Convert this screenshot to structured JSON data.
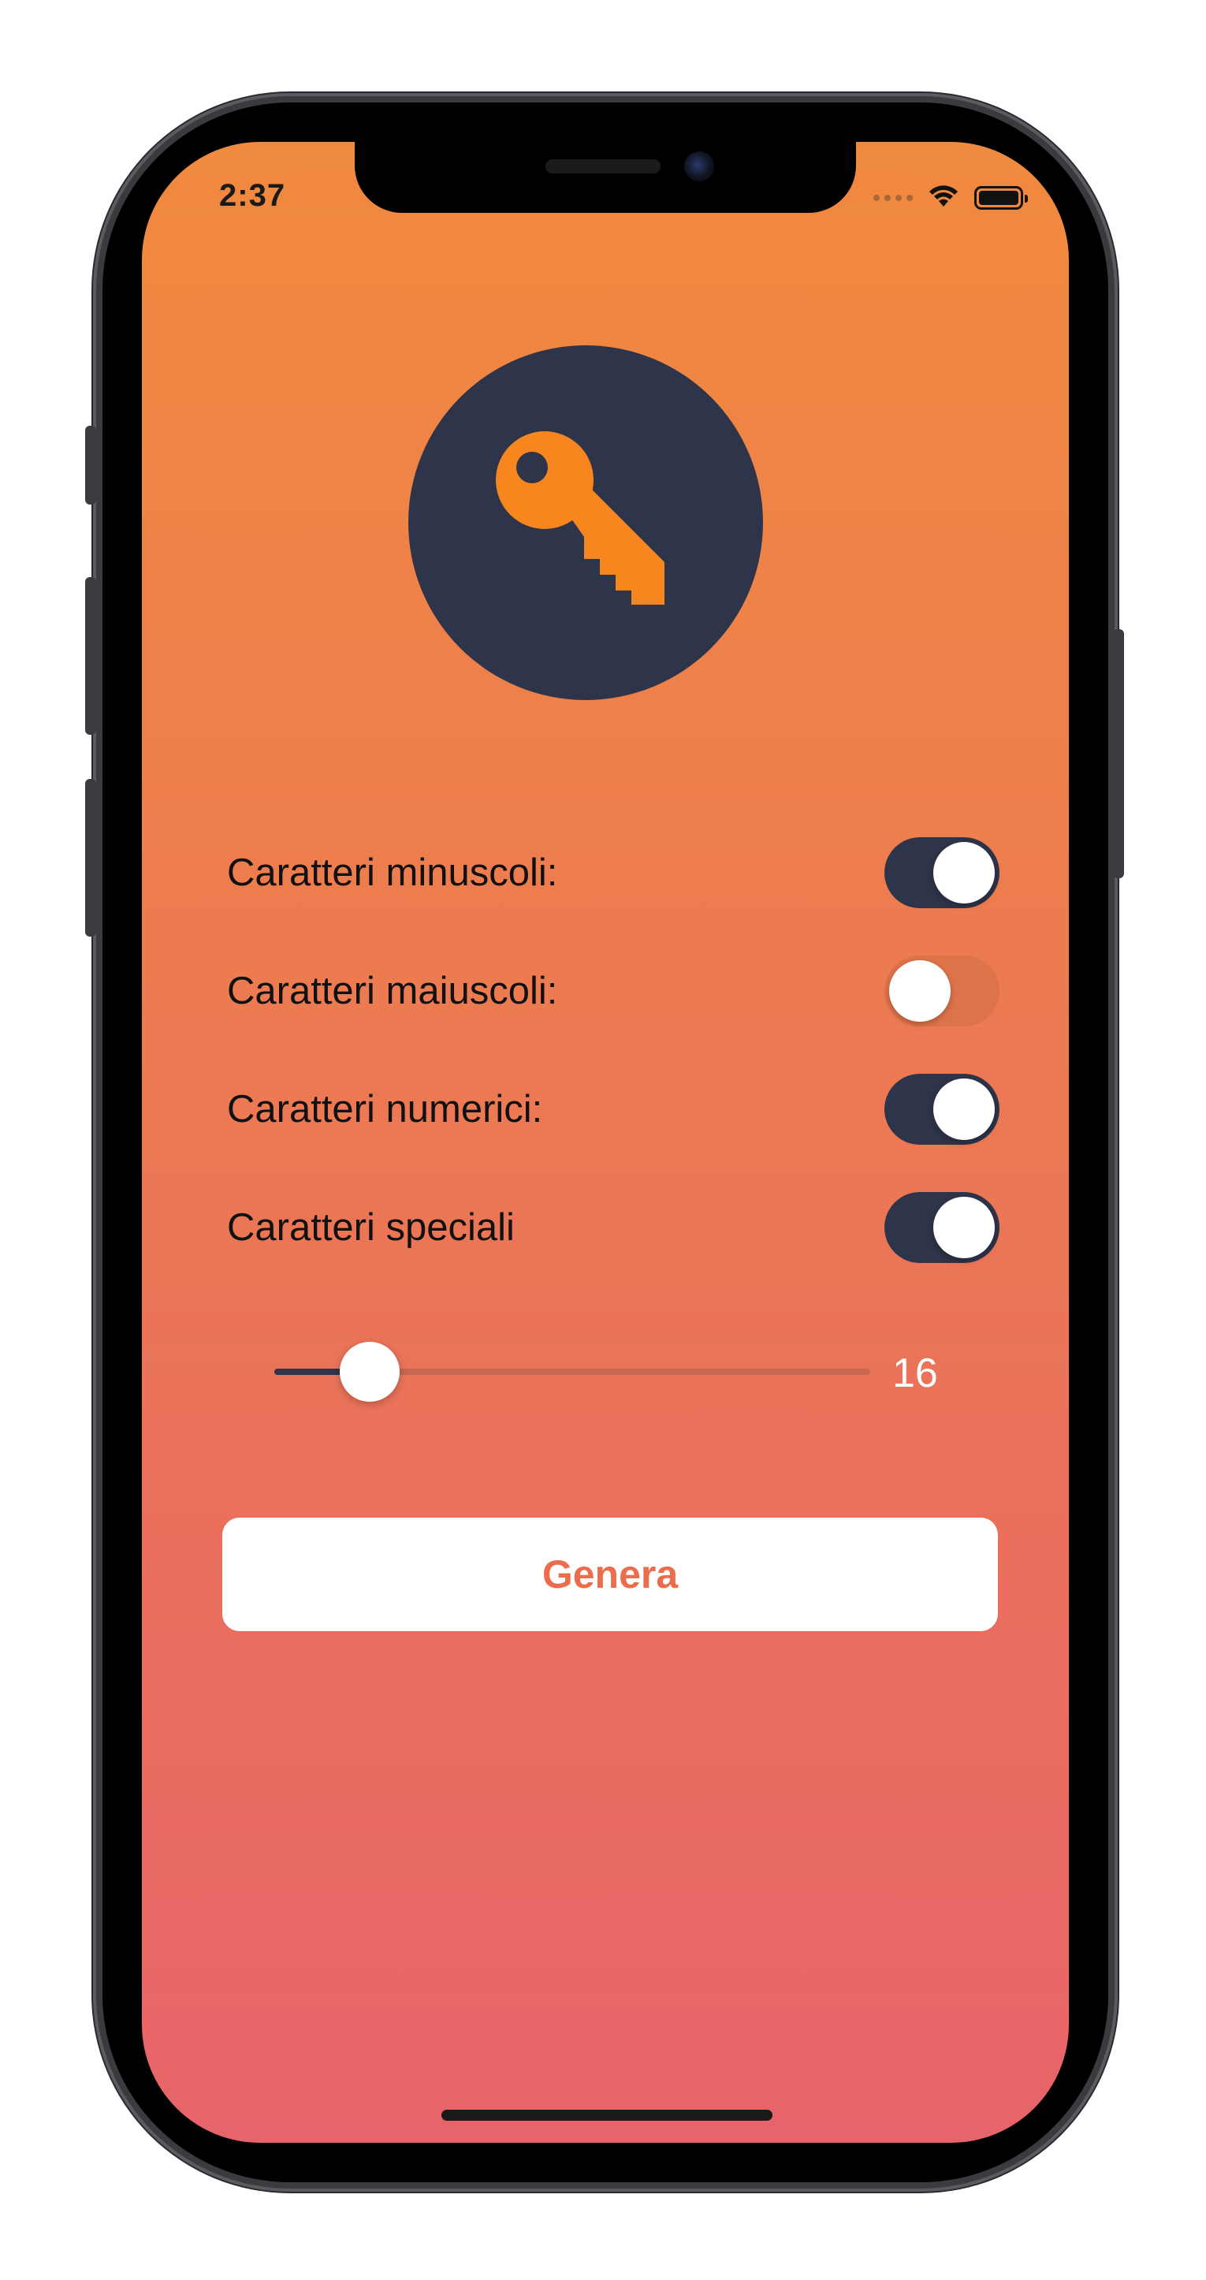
{
  "status_bar": {
    "time": "2:37",
    "wifi_icon": "wifi-icon",
    "battery_icon": "battery-icon"
  },
  "logo": {
    "icon": "key-icon",
    "circle_color": "#2e3449",
    "key_color": "#f7861e"
  },
  "options": [
    {
      "label": "Caratteri minuscoli:",
      "enabled": true
    },
    {
      "label": "Caratteri maiuscoli:",
      "enabled": false
    },
    {
      "label": "Caratteri numerici:",
      "enabled": true
    },
    {
      "label": "Caratteri speciali",
      "enabled": true
    }
  ],
  "length_slider": {
    "value": "16",
    "fill_fraction": 0.16
  },
  "generate_button": {
    "label": "Genera"
  },
  "colors": {
    "gradient_top": "#f08a3e",
    "gradient_bottom": "#e7646a",
    "accent_dark": "#2e3449",
    "button_text": "#ec6d4c"
  }
}
